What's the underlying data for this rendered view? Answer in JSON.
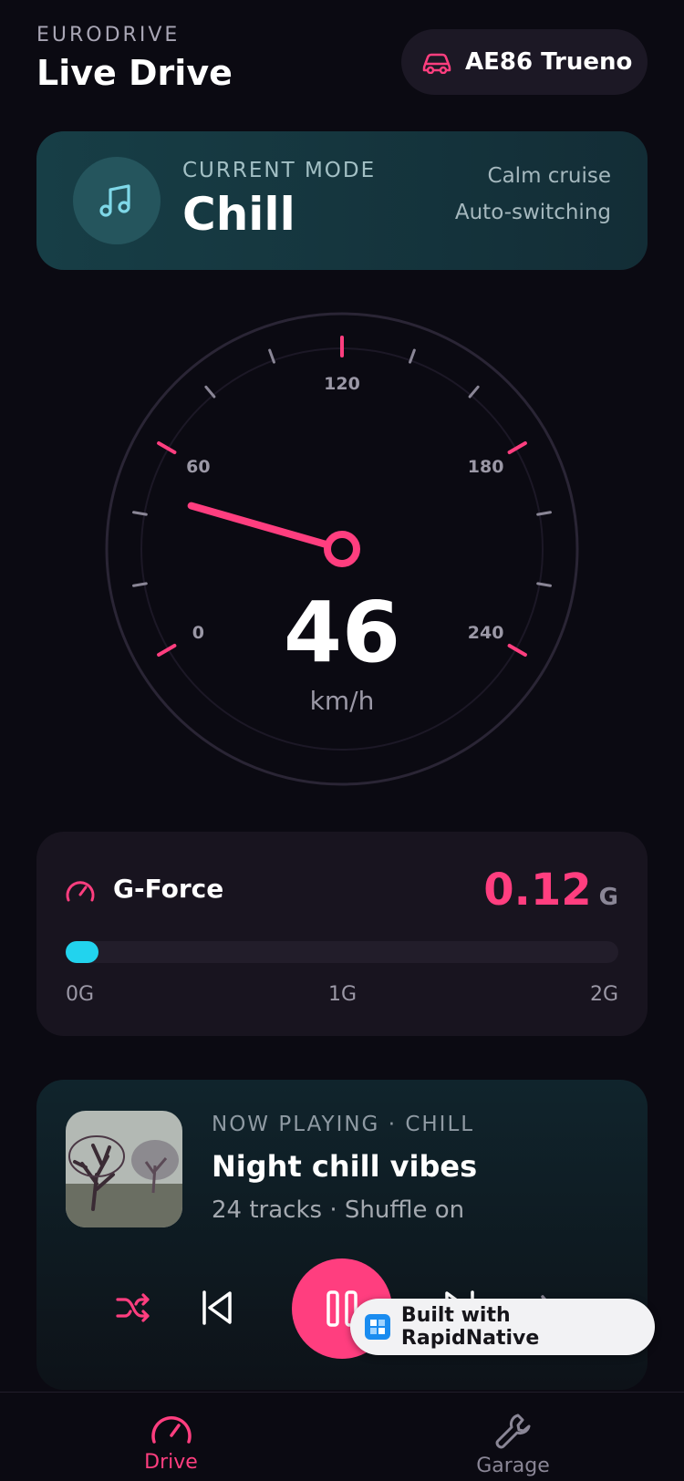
{
  "header": {
    "brand": "EURODRIVE",
    "title": "Live Drive",
    "car_name": "AE86 Trueno",
    "car_icon": "car-icon"
  },
  "mode": {
    "label": "CURRENT MODE",
    "value": "Chill",
    "description": "Calm cruise",
    "auto": "Auto-switching",
    "icon": "music-note-icon"
  },
  "speedometer": {
    "speed": "46",
    "unit": "km/h",
    "max": 240,
    "labels": [
      "0",
      "60",
      "120",
      "180",
      "240"
    ],
    "accent": "#ff3e7f"
  },
  "gforce": {
    "label": "G-Force",
    "value": "0.12",
    "unit": "G",
    "fraction": 0.06,
    "ticks": [
      "0G",
      "1G",
      "2G"
    ],
    "bar_color": "#22d3ee"
  },
  "now_playing": {
    "label": "NOW PLAYING · CHILL",
    "title": "Night chill vibes",
    "subtitle": "24 tracks · Shuffle on"
  },
  "badge": {
    "text": "Built with RapidNative"
  },
  "tabs": [
    {
      "label": "Drive",
      "icon": "speedometer-icon",
      "active": true
    },
    {
      "label": "Garage",
      "icon": "wrench-icon",
      "active": false
    }
  ]
}
